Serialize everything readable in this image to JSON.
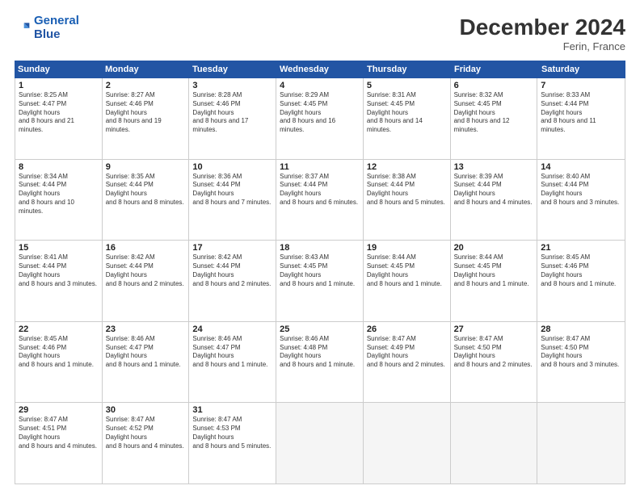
{
  "header": {
    "logo_line1": "General",
    "logo_line2": "Blue",
    "month_title": "December 2024",
    "location": "Ferin, France"
  },
  "days_of_week": [
    "Sunday",
    "Monday",
    "Tuesday",
    "Wednesday",
    "Thursday",
    "Friday",
    "Saturday"
  ],
  "weeks": [
    [
      {
        "day": "1",
        "sunrise": "8:25 AM",
        "sunset": "4:47 PM",
        "daylight": "8 hours and 21 minutes."
      },
      {
        "day": "2",
        "sunrise": "8:27 AM",
        "sunset": "4:46 PM",
        "daylight": "8 hours and 19 minutes."
      },
      {
        "day": "3",
        "sunrise": "8:28 AM",
        "sunset": "4:46 PM",
        "daylight": "8 hours and 17 minutes."
      },
      {
        "day": "4",
        "sunrise": "8:29 AM",
        "sunset": "4:45 PM",
        "daylight": "8 hours and 16 minutes."
      },
      {
        "day": "5",
        "sunrise": "8:31 AM",
        "sunset": "4:45 PM",
        "daylight": "8 hours and 14 minutes."
      },
      {
        "day": "6",
        "sunrise": "8:32 AM",
        "sunset": "4:45 PM",
        "daylight": "8 hours and 12 minutes."
      },
      {
        "day": "7",
        "sunrise": "8:33 AM",
        "sunset": "4:44 PM",
        "daylight": "8 hours and 11 minutes."
      }
    ],
    [
      {
        "day": "8",
        "sunrise": "8:34 AM",
        "sunset": "4:44 PM",
        "daylight": "8 hours and 10 minutes."
      },
      {
        "day": "9",
        "sunrise": "8:35 AM",
        "sunset": "4:44 PM",
        "daylight": "8 hours and 8 minutes."
      },
      {
        "day": "10",
        "sunrise": "8:36 AM",
        "sunset": "4:44 PM",
        "daylight": "8 hours and 7 minutes."
      },
      {
        "day": "11",
        "sunrise": "8:37 AM",
        "sunset": "4:44 PM",
        "daylight": "8 hours and 6 minutes."
      },
      {
        "day": "12",
        "sunrise": "8:38 AM",
        "sunset": "4:44 PM",
        "daylight": "8 hours and 5 minutes."
      },
      {
        "day": "13",
        "sunrise": "8:39 AM",
        "sunset": "4:44 PM",
        "daylight": "8 hours and 4 minutes."
      },
      {
        "day": "14",
        "sunrise": "8:40 AM",
        "sunset": "4:44 PM",
        "daylight": "8 hours and 3 minutes."
      }
    ],
    [
      {
        "day": "15",
        "sunrise": "8:41 AM",
        "sunset": "4:44 PM",
        "daylight": "8 hours and 3 minutes."
      },
      {
        "day": "16",
        "sunrise": "8:42 AM",
        "sunset": "4:44 PM",
        "daylight": "8 hours and 2 minutes."
      },
      {
        "day": "17",
        "sunrise": "8:42 AM",
        "sunset": "4:44 PM",
        "daylight": "8 hours and 2 minutes."
      },
      {
        "day": "18",
        "sunrise": "8:43 AM",
        "sunset": "4:45 PM",
        "daylight": "8 hours and 1 minute."
      },
      {
        "day": "19",
        "sunrise": "8:44 AM",
        "sunset": "4:45 PM",
        "daylight": "8 hours and 1 minute."
      },
      {
        "day": "20",
        "sunrise": "8:44 AM",
        "sunset": "4:45 PM",
        "daylight": "8 hours and 1 minute."
      },
      {
        "day": "21",
        "sunrise": "8:45 AM",
        "sunset": "4:46 PM",
        "daylight": "8 hours and 1 minute."
      }
    ],
    [
      {
        "day": "22",
        "sunrise": "8:45 AM",
        "sunset": "4:46 PM",
        "daylight": "8 hours and 1 minute."
      },
      {
        "day": "23",
        "sunrise": "8:46 AM",
        "sunset": "4:47 PM",
        "daylight": "8 hours and 1 minute."
      },
      {
        "day": "24",
        "sunrise": "8:46 AM",
        "sunset": "4:47 PM",
        "daylight": "8 hours and 1 minute."
      },
      {
        "day": "25",
        "sunrise": "8:46 AM",
        "sunset": "4:48 PM",
        "daylight": "8 hours and 1 minute."
      },
      {
        "day": "26",
        "sunrise": "8:47 AM",
        "sunset": "4:49 PM",
        "daylight": "8 hours and 2 minutes."
      },
      {
        "day": "27",
        "sunrise": "8:47 AM",
        "sunset": "4:50 PM",
        "daylight": "8 hours and 2 minutes."
      },
      {
        "day": "28",
        "sunrise": "8:47 AM",
        "sunset": "4:50 PM",
        "daylight": "8 hours and 3 minutes."
      }
    ],
    [
      {
        "day": "29",
        "sunrise": "8:47 AM",
        "sunset": "4:51 PM",
        "daylight": "8 hours and 4 minutes."
      },
      {
        "day": "30",
        "sunrise": "8:47 AM",
        "sunset": "4:52 PM",
        "daylight": "8 hours and 4 minutes."
      },
      {
        "day": "31",
        "sunrise": "8:47 AM",
        "sunset": "4:53 PM",
        "daylight": "8 hours and 5 minutes."
      },
      null,
      null,
      null,
      null
    ]
  ]
}
